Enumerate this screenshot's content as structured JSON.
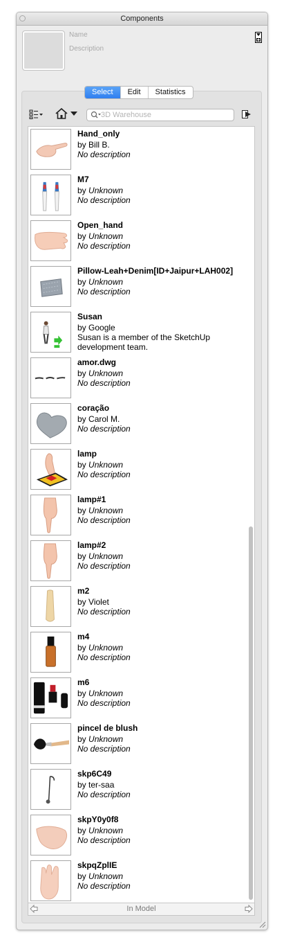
{
  "window": {
    "title": "Components"
  },
  "info": {
    "name_placeholder": "Name",
    "description_placeholder": "Description"
  },
  "tabs": [
    {
      "label": "Select",
      "active": true
    },
    {
      "label": "Edit",
      "active": false
    },
    {
      "label": "Statistics",
      "active": false
    }
  ],
  "toolbar": {
    "view_options_icon": "view-options-icon",
    "navigation_icon": "house-icon",
    "search_placeholder": "3D Warehouse",
    "details_icon": "details-arrow-icon"
  },
  "components": [
    {
      "name": "Hand_only",
      "by": "by",
      "author": "Bill B.",
      "author_italic": false,
      "description": "No description",
      "description_italic": true,
      "icon": "hand-pointing-icon"
    },
    {
      "name": "M7",
      "by": "by",
      "author": "Unknown",
      "author_italic": true,
      "description": "No description",
      "description_italic": true,
      "icon": "brushes-icon"
    },
    {
      "name": "Open_hand",
      "by": "by",
      "author": "Unknown",
      "author_italic": true,
      "description": "No description",
      "description_italic": true,
      "icon": "open-hand-icon"
    },
    {
      "name": "Pillow-Leah+Denim[ID+Jaipur+LAH002]",
      "by": "by",
      "author": "Unknown",
      "author_italic": true,
      "description": "No description",
      "description_italic": true,
      "icon": "pillow-icon"
    },
    {
      "name": "Susan",
      "by": "by",
      "author": "Google",
      "author_italic": false,
      "description": "Susan is a member of the SketchUp development team.",
      "description_italic": false,
      "icon": "person-icon"
    },
    {
      "name": "amor.dwg",
      "by": "by",
      "author": "Unknown",
      "author_italic": true,
      "description": "No description",
      "description_italic": true,
      "icon": "lines-icon"
    },
    {
      "name": "coração",
      "by": "by",
      "author": "Carol M.",
      "author_italic": false,
      "description": "No description",
      "description_italic": true,
      "icon": "heart-icon"
    },
    {
      "name": "lamp",
      "by": "by",
      "author": "Unknown",
      "author_italic": true,
      "description": "No description",
      "description_italic": true,
      "icon": "lamp-hand-icon"
    },
    {
      "name": "lamp#1",
      "by": "by",
      "author": "Unknown",
      "author_italic": true,
      "description": "No description",
      "description_italic": true,
      "icon": "hand-down-icon"
    },
    {
      "name": "lamp#2",
      "by": "by",
      "author": "Unknown",
      "author_italic": true,
      "description": "No description",
      "description_italic": true,
      "icon": "hand-down-icon"
    },
    {
      "name": "m2",
      "by": "by",
      "author": "Violet",
      "author_italic": false,
      "description": "No description",
      "description_italic": true,
      "icon": "tube-icon"
    },
    {
      "name": "m4",
      "by": "by",
      "author": "Unknown",
      "author_italic": true,
      "description": "No description",
      "description_italic": true,
      "icon": "bottle-icon"
    },
    {
      "name": "m6",
      "by": "by",
      "author": "Unknown",
      "author_italic": true,
      "description": "No description",
      "description_italic": true,
      "icon": "lipstick-icon"
    },
    {
      "name": "pincel de blush",
      "by": "by",
      "author": "Unknown",
      "author_italic": true,
      "description": "No description",
      "description_italic": true,
      "icon": "blush-brush-icon"
    },
    {
      "name": "skp6C49",
      "by": "by",
      "author": "ter-saa",
      "author_italic": false,
      "description": "No description",
      "description_italic": true,
      "icon": "lamp-icon"
    },
    {
      "name": "skpY0y0f8",
      "by": "by",
      "author": "Unknown",
      "author_italic": true,
      "description": "No description",
      "description_italic": true,
      "icon": "palm-icon"
    },
    {
      "name": "skpqZplIE",
      "by": "by",
      "author": "Unknown",
      "author_italic": true,
      "description": "No description",
      "description_italic": true,
      "icon": "hand-up-icon"
    }
  ],
  "status": {
    "text": "In Model"
  }
}
